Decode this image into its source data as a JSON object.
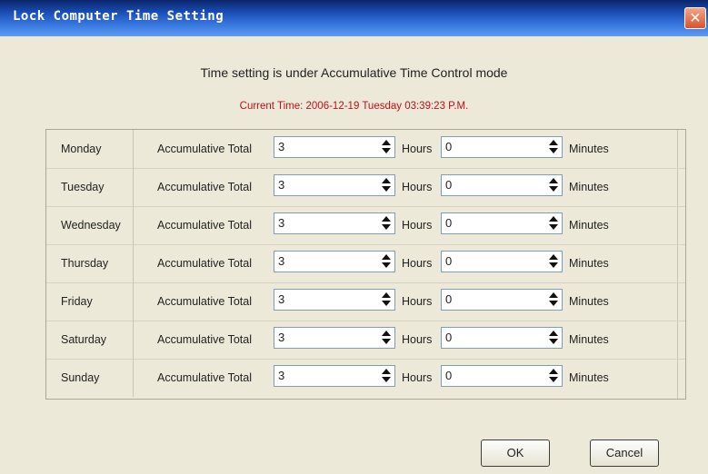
{
  "window": {
    "title": "Lock Computer Time Setting"
  },
  "heading": "Time setting is under Accumulative Time Control mode",
  "current_time": "Current Time: 2006-12-19 Tuesday 03:39:23 P.M.",
  "rows": [
    {
      "day": "Monday",
      "accumulative_label": "Accumulative Total",
      "hours": "3",
      "hours_label": "Hours",
      "minutes": "0",
      "minutes_label": "Minutes"
    },
    {
      "day": "Tuesday",
      "accumulative_label": "Accumulative Total",
      "hours": "3",
      "hours_label": "Hours",
      "minutes": "0",
      "minutes_label": "Minutes"
    },
    {
      "day": "Wednesday",
      "accumulative_label": "Accumulative Total",
      "hours": "3",
      "hours_label": "Hours",
      "minutes": "0",
      "minutes_label": "Minutes"
    },
    {
      "day": "Thursday",
      "accumulative_label": "Accumulative Total",
      "hours": "3",
      "hours_label": "Hours",
      "minutes": "0",
      "minutes_label": "Minutes"
    },
    {
      "day": "Friday",
      "accumulative_label": "Accumulative Total",
      "hours": "3",
      "hours_label": "Hours",
      "minutes": "0",
      "minutes_label": "Minutes"
    },
    {
      "day": "Saturday",
      "accumulative_label": "Accumulative Total",
      "hours": "3",
      "hours_label": "Hours",
      "minutes": "0",
      "minutes_label": "Minutes"
    },
    {
      "day": "Sunday",
      "accumulative_label": "Accumulative Total",
      "hours": "3",
      "hours_label": "Hours",
      "minutes": "0",
      "minutes_label": "Minutes"
    }
  ],
  "buttons": {
    "ok": "OK",
    "cancel": "Cancel"
  },
  "colors": {
    "current_time": "#c0101a",
    "titlebar": "#1a4fb8",
    "dialog_bg": "#ece9d8"
  }
}
